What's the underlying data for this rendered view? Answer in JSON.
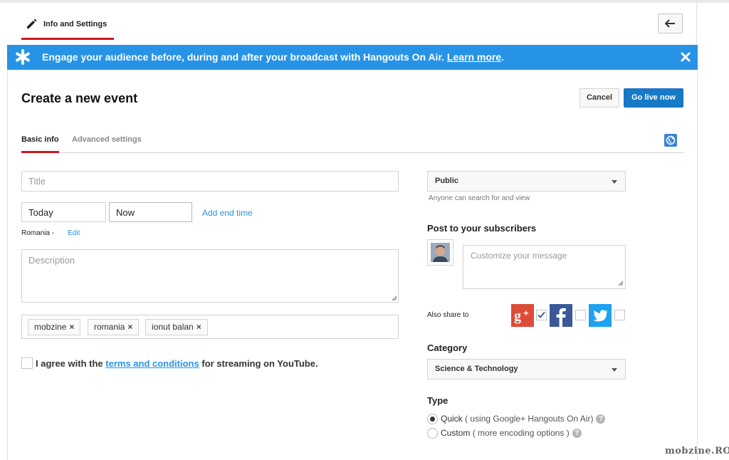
{
  "header": {
    "tab_label": "Info and Settings"
  },
  "banner": {
    "text": "Engage your audience before, during and after your broadcast with Hangouts On Air.",
    "link": "Learn more",
    "period": "."
  },
  "page": {
    "title": "Create a new event",
    "cancel_label": "Cancel",
    "golive_label": "Go live now"
  },
  "tabs": [
    {
      "label": "Basic info",
      "active": true
    },
    {
      "label": "Advanced settings",
      "active": false
    }
  ],
  "form": {
    "title_placeholder": "Title",
    "date_value": "Today",
    "time_value": "Now",
    "add_end_time": "Add end time",
    "timezone": "Romania -",
    "timezone_edit": "Edit",
    "description_placeholder": "Description",
    "tags": [
      "mobzine",
      "romania",
      "ionut balan"
    ],
    "tag_remove_glyph": "×",
    "agree_prefix": "I agree with the",
    "agree_link": "terms and conditions",
    "agree_suffix": "for streaming on YouTube."
  },
  "sidebar": {
    "privacy_value": "Public",
    "privacy_hint": "Anyone can search for and view",
    "post_heading": "Post to your subscribers",
    "message_placeholder": "Customize your message",
    "share_label": "Also share to",
    "share_targets": [
      {
        "name": "google-plus",
        "checked": true,
        "color": "#dd4b39"
      },
      {
        "name": "facebook",
        "checked": false,
        "color": "#3b5998"
      },
      {
        "name": "twitter",
        "checked": false,
        "color": "#1da1f2"
      }
    ],
    "category_heading": "Category",
    "category_value": "Science & Technology",
    "type_heading": "Type",
    "type_options": [
      {
        "label": "Quick",
        "detail": "( using Google+ Hangouts On Air)",
        "selected": true
      },
      {
        "label": "Custom",
        "detail": "( more encoding options )",
        "selected": false
      }
    ]
  },
  "colors": {
    "accent_blue": "#2793e6",
    "brand_red": "#cc181e",
    "primary_button": "#167ac6"
  },
  "watermark": "mobzine.RO"
}
